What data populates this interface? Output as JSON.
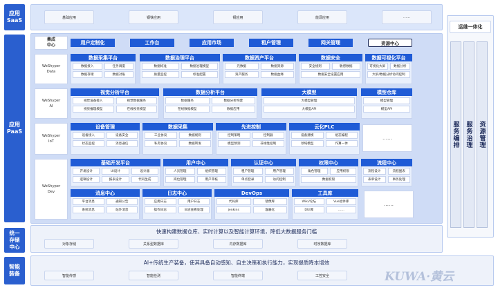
{
  "layers": {
    "saas": "应用\nSaaS",
    "paas": "应用\nPaaS",
    "storage": "统一\n存储\n中心",
    "equip": "智能\n装备"
  },
  "saas_items": [
    "基础应用",
    "钢铁应用",
    "钢应用",
    "能源应用",
    "……"
  ],
  "ops_title": "运维一体化",
  "integration_label": "集成\n中心",
  "integration_tabs": [
    "用户定制化",
    "工作台",
    "应用市场",
    "租户管理",
    "网关管理",
    "资源中心"
  ],
  "side_cols": [
    "服务编排",
    "服务治理",
    "资源管理"
  ],
  "row_labels": [
    "WeShyper\nData",
    "WeShyper\nAI",
    "WeShyper\nIoT",
    "WeShyper\nDev"
  ],
  "data_row": [
    {
      "title": "数据采集平台",
      "items": [
        "数据接入",
        "任务调度",
        "数据存储",
        "数据对账"
      ]
    },
    {
      "title": "数据治理平台",
      "items": [
        "数据标准",
        "数据治理模型",
        "质量监控",
        "标准配置"
      ]
    },
    {
      "title": "数据资产平台",
      "items": [
        "元数据",
        "数据资源",
        "资产服务",
        "数据血缘"
      ]
    },
    {
      "title": "数据安全",
      "items": [
        "安全规则",
        "敏感数据",
        "数据安全设置应用"
      ]
    },
    {
      "title": "数据可视化平台",
      "items": [
        "可视化大屏",
        "数据分析",
        "大屏/数据分析访问控制"
      ]
    }
  ],
  "ai_row": [
    {
      "title": "视觉分析平台",
      "items": [
        "视觉设备接入",
        "视觉数据服务",
        "视觉推理模型",
        "在线视觉模型"
      ]
    },
    {
      "title": "数据分析平台",
      "items": [
        "数据服务",
        "数据分析构建",
        "在线数据模型",
        "数据应用"
      ]
    },
    {
      "title": "大模型",
      "items": [
        "大模型管理",
        "大模型API"
      ]
    },
    {
      "title": "模型仓库",
      "items": [
        "模型管理",
        "模型API"
      ]
    }
  ],
  "iot_row": [
    {
      "title": "设备管理",
      "items": [
        "设备接入",
        "设备安全",
        "状态监控",
        "消息通信"
      ]
    },
    {
      "title": "数据采集",
      "items": [
        "工业协议",
        "数据规则",
        "私有协议",
        "数据转发"
      ]
    },
    {
      "title": "先进控制",
      "items": [
        "控制策略",
        "控制器",
        "模型预测",
        "非线性控制"
      ]
    },
    {
      "title": "云化PLC",
      "items": [
        "设备建模",
        "组态编程",
        "领域模型",
        "作算一体"
      ]
    }
  ],
  "dev_row1": [
    {
      "title": "基础开发平台",
      "items": [
        "开发设计",
        "UI设计",
        "设计器",
        "逻辑设计",
        "报表设计",
        "代码生成"
      ]
    },
    {
      "title": "用户中心",
      "items": [
        "人员管理",
        "组织管理",
        "岗位管理",
        "用户审核"
      ]
    },
    {
      "title": "认证中心",
      "items": [
        "租户管理",
        "用户管理",
        "单点登录",
        "访问控制"
      ]
    },
    {
      "title": "权限中心",
      "items": [
        "角色管理",
        "应用权限",
        "数据权限"
      ]
    },
    {
      "title": "流程中心",
      "items": [
        "流程设计",
        "流程图表",
        "表单设计",
        "事务处理"
      ]
    }
  ],
  "dev_row2": [
    {
      "title": "消息中心",
      "items": [
        "平台消息",
        "通知公告",
        "系统消息",
        "站外消息"
      ]
    },
    {
      "title": "日志中心",
      "items": [
        "应用日志",
        "用户日志",
        "操作日志",
        "日志查看处理"
      ]
    },
    {
      "title": "DevOps",
      "items": [
        "代码库",
        "镜像库",
        "jenkins",
        "容器化"
      ]
    },
    {
      "title": "工具库",
      "items": [
        "Wiki/论坛",
        "Vue组件库",
        "DUI库",
        "……"
      ]
    }
  ],
  "dots": "……",
  "storage_note": "快速构建数据仓库、实时计算以及智能计算环境，降低大数据服务门槛",
  "storage_items": [
    "对象存储",
    "关系型数据库",
    "内存数据库",
    "时序数据库"
  ],
  "equip_note": "AI+传统生产装备，使其具备自动感知、自主决策和执行能力，实现提质降本增效",
  "equip_items": [
    "智能传感",
    "智能检测",
    "智能终端",
    "工控安全"
  ],
  "watermark": "KUWA·黄云"
}
